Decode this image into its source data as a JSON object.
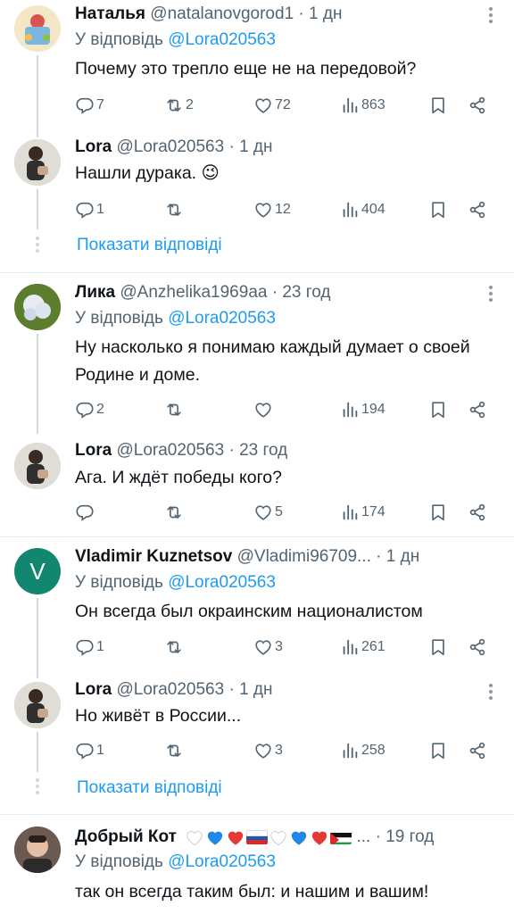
{
  "threads": [
    {
      "name": "Наталья",
      "handle": "@natalanovgorod1",
      "time": "1 дн",
      "reply_label": "У відповідь",
      "reply_mention": "@Lora020563",
      "text": "Почему это трепло еще не на передовой?",
      "stats": {
        "replies": "7",
        "reposts": "2",
        "likes": "72",
        "views": "863"
      }
    },
    {
      "name": "Lora",
      "handle": "@Lora020563",
      "time": "1 дн",
      "text": "Нашли дурака. 😉",
      "stats": {
        "replies": "1",
        "reposts": "",
        "likes": "12",
        "views": "404"
      }
    },
    {
      "name": "Лика",
      "handle": "@Anzhelika1969aa",
      "time": "23 год",
      "reply_label": "У відповідь",
      "reply_mention": "@Lora020563",
      "text": "Ну насколько я понимаю каждый думает о своей Родине и доме.",
      "stats": {
        "replies": "2",
        "reposts": "",
        "likes": "",
        "views": "194"
      }
    },
    {
      "name": "Lora",
      "handle": "@Lora020563",
      "time": "23 год",
      "text": "Ага. И ждёт победы кого?",
      "stats": {
        "replies": "",
        "reposts": "",
        "likes": "5",
        "views": "174"
      }
    },
    {
      "name": "Vladimir Kuznetsov",
      "handle": "@Vladimi96709...",
      "time": "1 дн",
      "avatar_letter": "V",
      "reply_label": "У відповідь",
      "reply_mention": "@Lora020563",
      "text": "Он всегда был окраинским националистом",
      "stats": {
        "replies": "1",
        "reposts": "",
        "likes": "3",
        "views": "261"
      }
    },
    {
      "name": "Lora",
      "handle": "@Lora020563",
      "time": "1 дн",
      "text": "Но живёт в России...",
      "stats": {
        "replies": "1",
        "reposts": "",
        "likes": "3",
        "views": "258"
      }
    },
    {
      "name": "Добрый Кот",
      "handle": "...",
      "time": "19 год",
      "reply_label": "У відповідь",
      "reply_mention": "@Lora020563",
      "text": "так он всегда таким был: и нашим и вашим!"
    }
  ],
  "show_replies_label": "Показати відповіді",
  "colors": {
    "accent": "#1d9bf0",
    "muted": "#536471",
    "text": "#0f1419",
    "divider": "#e6ecf0",
    "vavatar": "#12876f"
  },
  "icons": [
    "reply-icon",
    "repost-icon",
    "like-icon",
    "views-icon",
    "bookmark-icon",
    "share-icon",
    "more-icon"
  ]
}
